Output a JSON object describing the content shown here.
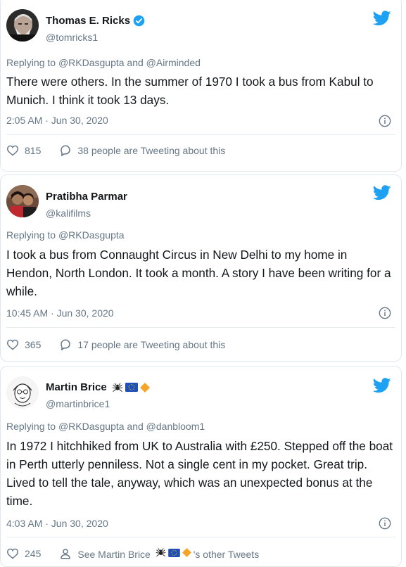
{
  "tweets": [
    {
      "author_name": "Thomas E. Ricks",
      "handle": "@tomricks1",
      "verified": true,
      "replying_prefix": "Replying to ",
      "replying_to": [
        "@RKDasgupta",
        "@Airminded"
      ],
      "replying_joiner": " and ",
      "text": "There were others. In the summer of 1970 I took a bus from Kabul to Munich. I think it took 13 days.",
      "timestamp": "2:05 AM · Jun 30, 2020",
      "likes": "815",
      "secondary_action": "38 people are Tweeting about this"
    },
    {
      "author_name": "Pratibha Parmar",
      "handle": "@kalifilms",
      "verified": false,
      "replying_prefix": "Replying to ",
      "replying_to": [
        "@RKDasgupta"
      ],
      "text": "I took a bus from Connaught Circus in New Delhi to my home in Hendon, North London. It took a month. A story I have been writing for a while.",
      "timestamp": "10:45 AM · Jun 30, 2020",
      "likes": "365",
      "secondary_action": "17 people are Tweeting about this"
    },
    {
      "author_name": "Martin Brice",
      "handle": "@martinbrice1",
      "verified": false,
      "name_emojis": [
        "spider-icon",
        "eu-flag-icon",
        "orange-diamond-icon"
      ],
      "replying_prefix": "Replying to ",
      "replying_to": [
        "@RKDasgupta",
        "@danbloom1"
      ],
      "replying_joiner": " and ",
      "text": "In 1972 I hitchhiked from UK to Australia with £250. Stepped off the boat in Perth utterly penniless. Not a single cent in my pocket. Great trip. Lived to tell the tale, anyway, which was an unexpected bonus at the time.",
      "timestamp": "4:03 AM · Jun 30, 2020",
      "likes": "245",
      "secondary_action_prefix": "See Martin Brice",
      "secondary_action_suffix": "'s other Tweets"
    }
  ],
  "colors": {
    "twitter_blue": "#1da1f2",
    "muted_text": "#657786",
    "border": "#e1e8ed"
  }
}
